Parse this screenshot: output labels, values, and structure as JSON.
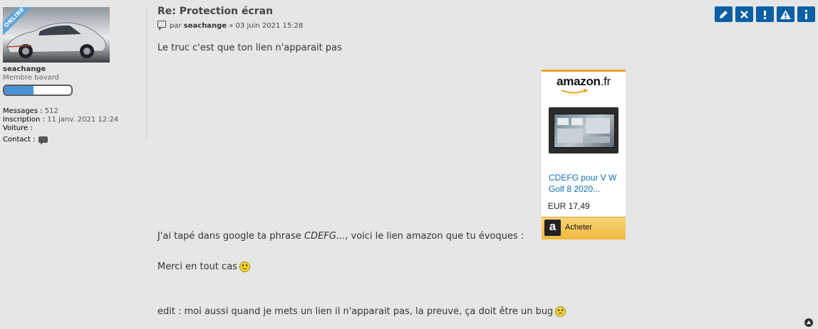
{
  "profile": {
    "online_badge": "ONLINE",
    "username": "seachange",
    "rank": "Membre bavard",
    "rank_progress": 0.44,
    "stats": {
      "messages_label": "Messages :",
      "messages_value": "512",
      "inscription_label": "Inscription :",
      "inscription_value": "11 janv. 2021 12:24",
      "voiture_label": "Voiture :",
      "contact_label": "Contact :"
    }
  },
  "post": {
    "title": "Re: Protection écran",
    "meta_by": "par",
    "author": "seachange",
    "meta_date": "» 03 juin 2021 15:28",
    "line1": "Le truc c'est que ton lien n'apparait pas",
    "line2_before": "J'ai tapé dans google ta phrase ",
    "line2_italic": "CDEFG...",
    "line2_after": ", voici le lien amazon que tu évoques :",
    "line3": "Merci en tout cas",
    "line4": "edit : moi aussi quand je mets un lien il n'apparait pas, la preuve, ça doit être un bug"
  },
  "amazon_widget": {
    "logo": "amazon",
    "logo_suffix": ".fr",
    "product_title": "CDEFG pour V W Golf 8 2020...",
    "price": "EUR 17,49",
    "buy_label": "Acheter",
    "logo_letter": "a"
  },
  "actions": [
    {
      "icon": "pencil-icon",
      "name": "edit-button"
    },
    {
      "icon": "close-icon",
      "name": "delete-button"
    },
    {
      "icon": "exclamation-icon",
      "name": "warn-button"
    },
    {
      "icon": "warning-triangle-icon",
      "name": "report-button"
    },
    {
      "icon": "info-icon",
      "name": "info-button"
    }
  ],
  "colors": {
    "background": "#e6e6e6",
    "action_blue": "#0b5fa5",
    "online_blue": "#5aa4d8",
    "amazon_orange": "#f0a12a",
    "link_blue": "#0e6fb3"
  }
}
